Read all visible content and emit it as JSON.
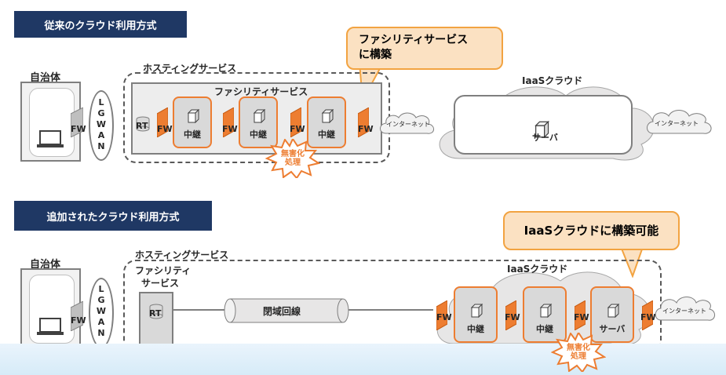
{
  "top": {
    "header": "従来のクラウド利用方式",
    "callout_line1": "ファシリティサービス",
    "callout_line2": "に構築",
    "municipality": "自治体",
    "lgwan_letters": [
      "L",
      "G",
      "W",
      "A",
      "N"
    ],
    "hosting": "ホスティングサービス",
    "facility": "ファシリティサービス",
    "rt": "RT",
    "fw": "FW",
    "relay": "中継",
    "invalidate_line1": "無害化",
    "invalidate_line2": "処理",
    "internet": "インターネット",
    "iaas": "IaaSクラウド",
    "server": "サーバ"
  },
  "bottom": {
    "header": "追加されたクラウド利用方式",
    "callout": "IaaSクラウドに構築可能",
    "municipality": "自治体",
    "lgwan_letters": [
      "L",
      "G",
      "W",
      "A",
      "N"
    ],
    "hosting": "ホスティングサービス",
    "facility_line1": "ファシリティ",
    "facility_line2": "サービス",
    "rt": "RT",
    "closed_line": "閉域回線",
    "fw": "FW",
    "iaas": "IaaSクラウド",
    "relay": "中継",
    "server": "サーバ",
    "invalidate_line1": "無害化",
    "invalidate_line2": "処理",
    "internet": "インターネット"
  },
  "colors": {
    "header_bg": "#1f3864",
    "accent_orange": "#ed7d31",
    "callout_fill": "#fbe1c2",
    "callout_border": "#f2a341"
  },
  "icons": [
    "laptop-icon",
    "router-icon",
    "firewall-icon",
    "server-cube-icon",
    "cloud-icon",
    "starburst-badge"
  ]
}
